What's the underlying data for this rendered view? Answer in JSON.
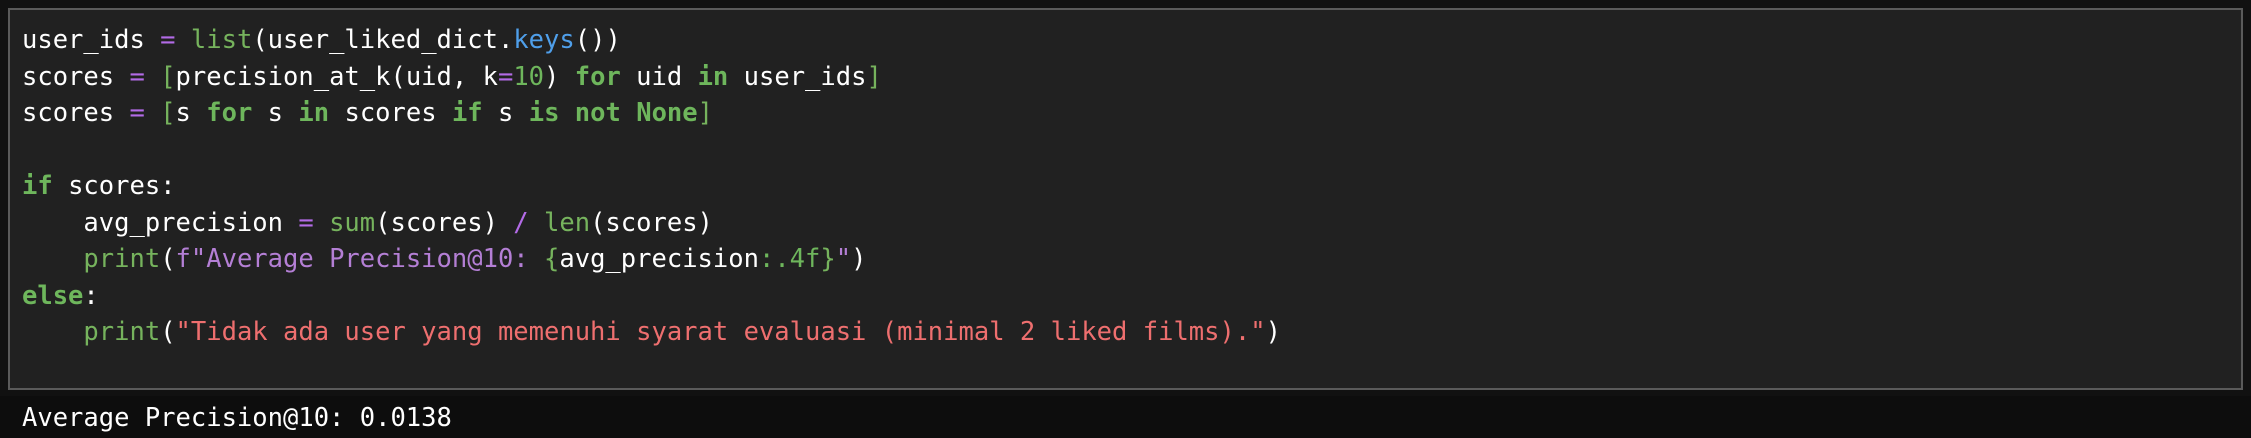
{
  "code_cell": {
    "lines": [
      [
        {
          "t": "user_ids ",
          "c": "punc"
        },
        {
          "t": "=",
          "c": "op"
        },
        {
          "t": " ",
          "c": "punc"
        },
        {
          "t": "list",
          "c": "fn"
        },
        {
          "t": "(user_liked_dict.",
          "c": "punc"
        },
        {
          "t": "keys",
          "c": "attr"
        },
        {
          "t": "())",
          "c": "punc"
        }
      ],
      [
        {
          "t": "scores ",
          "c": "punc"
        },
        {
          "t": "=",
          "c": "op"
        },
        {
          "t": " ",
          "c": "punc"
        },
        {
          "t": "[",
          "c": "brk"
        },
        {
          "t": "precision_at_k(uid, k",
          "c": "punc"
        },
        {
          "t": "=",
          "c": "op"
        },
        {
          "t": "10",
          "c": "num"
        },
        {
          "t": ") ",
          "c": "punc"
        },
        {
          "t": "for",
          "c": "kw"
        },
        {
          "t": " uid ",
          "c": "punc"
        },
        {
          "t": "in",
          "c": "kw"
        },
        {
          "t": " user_ids",
          "c": "punc"
        },
        {
          "t": "]",
          "c": "brk"
        }
      ],
      [
        {
          "t": "scores ",
          "c": "punc"
        },
        {
          "t": "=",
          "c": "op"
        },
        {
          "t": " ",
          "c": "punc"
        },
        {
          "t": "[",
          "c": "brk"
        },
        {
          "t": "s ",
          "c": "punc"
        },
        {
          "t": "for",
          "c": "kw"
        },
        {
          "t": " s ",
          "c": "punc"
        },
        {
          "t": "in",
          "c": "kw"
        },
        {
          "t": " scores ",
          "c": "punc"
        },
        {
          "t": "if",
          "c": "kw"
        },
        {
          "t": " s ",
          "c": "punc"
        },
        {
          "t": "is",
          "c": "kw"
        },
        {
          "t": " ",
          "c": "punc"
        },
        {
          "t": "not",
          "c": "kw"
        },
        {
          "t": " ",
          "c": "punc"
        },
        {
          "t": "None",
          "c": "kw"
        },
        {
          "t": "]",
          "c": "brk"
        }
      ],
      [],
      [
        {
          "t": "if",
          "c": "kw"
        },
        {
          "t": " scores:",
          "c": "punc"
        }
      ],
      [
        {
          "t": "    avg_precision ",
          "c": "punc"
        },
        {
          "t": "=",
          "c": "op"
        },
        {
          "t": " ",
          "c": "punc"
        },
        {
          "t": "sum",
          "c": "fn"
        },
        {
          "t": "(scores) ",
          "c": "punc"
        },
        {
          "t": "/",
          "c": "op"
        },
        {
          "t": " ",
          "c": "punc"
        },
        {
          "t": "len",
          "c": "fn"
        },
        {
          "t": "(scores)",
          "c": "punc"
        }
      ],
      [
        {
          "t": "    ",
          "c": "punc"
        },
        {
          "t": "print",
          "c": "fn"
        },
        {
          "t": "(",
          "c": "punc"
        },
        {
          "t": "f\"Average Precision@10: ",
          "c": "fstr"
        },
        {
          "t": "{",
          "c": "brk"
        },
        {
          "t": "avg_precision",
          "c": "punc"
        },
        {
          "t": ":.4f",
          "c": "num"
        },
        {
          "t": "}",
          "c": "brk"
        },
        {
          "t": "\"",
          "c": "fstr"
        },
        {
          "t": ")",
          "c": "punc"
        }
      ],
      [
        {
          "t": "else",
          "c": "kw"
        },
        {
          "t": ":",
          "c": "punc"
        }
      ],
      [
        {
          "t": "    ",
          "c": "punc"
        },
        {
          "t": "print",
          "c": "fn"
        },
        {
          "t": "(",
          "c": "punc"
        },
        {
          "t": "\"Tidak ada user yang memenuhi syarat evaluasi (minimal 2 liked films).\"",
          "c": "str"
        },
        {
          "t": ")",
          "c": "punc"
        }
      ]
    ]
  },
  "output": {
    "text": "Average Precision@10: 0.0138"
  },
  "colors": {
    "cell_background": "#212121",
    "cell_border": "#5a5a5a",
    "output_background": "#0d0d0d",
    "keyword": "#6eb65c",
    "operator": "#b36be7",
    "builtin": "#76b35d",
    "attribute": "#4f9fea",
    "string": "#ee6f6f",
    "fstring": "#b47fd5"
  }
}
